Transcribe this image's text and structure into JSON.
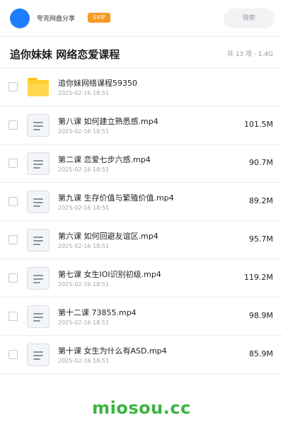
{
  "topbar": {
    "username": "夸克网盘分享",
    "badge": "SVIP",
    "search_placeholder": "搜索"
  },
  "header": {
    "title": "追你妹妹 网络恋爱课程",
    "meta": "共 13 项 · 1.4G"
  },
  "files": [
    {
      "type": "folder",
      "name": "追你妹网络课程59350",
      "date": "2025-02-16 18:51",
      "size": ""
    },
    {
      "type": "file",
      "name": "第八课 如何建立熟悉感.mp4",
      "date": "2025-02-16 18:51",
      "size": "101.5M"
    },
    {
      "type": "file",
      "name": "第二课 恋爱七步六感.mp4",
      "date": "2025-02-16 18:51",
      "size": "90.7M"
    },
    {
      "type": "file",
      "name": "第九课 生存价值与繁殖价值.mp4",
      "date": "2025-02-16 18:51",
      "size": "89.2M"
    },
    {
      "type": "file",
      "name": "第六课 如何回避友谊区.mp4",
      "date": "2025-02-16 18:51",
      "size": "95.7M"
    },
    {
      "type": "file",
      "name": "第七课 女生IOI识别初级.mp4",
      "date": "2025-02-16 18:51",
      "size": "119.2M"
    },
    {
      "type": "file",
      "name": "第十二课 73855.mp4",
      "date": "2025-02-16 18:51",
      "size": "98.9M"
    },
    {
      "type": "file",
      "name": "第十课 女生为什么有ASD.mp4",
      "date": "2025-02-16 18:51",
      "size": "85.9M"
    }
  ],
  "footer": {
    "watermark": "miosou.cc"
  },
  "colors": {
    "avatar": "#1e7cff",
    "badge": "#f59a23",
    "folder": "#ffcf2e",
    "watermark": "#3cb43f"
  },
  "icons": {
    "folder": "folder-icon",
    "file": "video-file-icon"
  }
}
